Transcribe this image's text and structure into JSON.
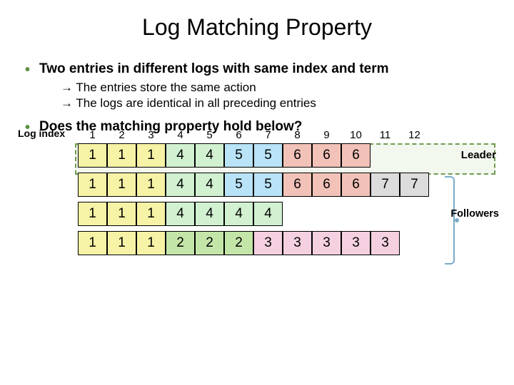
{
  "title": "Log Matching Property",
  "bullet1": "Two entries in different logs with same index and term",
  "sub1": "→ The entries store the same action",
  "sub2": "→ The logs are identical in all preceding entries",
  "bullet2": "Does the matching property hold below?",
  "logIndexLabel": "Log index",
  "indices": [
    "1",
    "2",
    "3",
    "4",
    "5",
    "6",
    "7",
    "8",
    "9",
    "10",
    "11",
    "12"
  ],
  "leaderLabel": "Leader",
  "followersLabel": "Followers",
  "rows": [
    {
      "role": "leader",
      "cells": [
        {
          "v": "1",
          "c": "c1"
        },
        {
          "v": "1",
          "c": "c1"
        },
        {
          "v": "1",
          "c": "c1"
        },
        {
          "v": "4",
          "c": "c3"
        },
        {
          "v": "4",
          "c": "c3"
        },
        {
          "v": "5",
          "c": "c4"
        },
        {
          "v": "5",
          "c": "c4"
        },
        {
          "v": "6",
          "c": "c5"
        },
        {
          "v": "6",
          "c": "c5"
        },
        {
          "v": "6",
          "c": "c5"
        }
      ]
    },
    {
      "role": "follower",
      "cells": [
        {
          "v": "1",
          "c": "c1"
        },
        {
          "v": "1",
          "c": "c1"
        },
        {
          "v": "1",
          "c": "c1"
        },
        {
          "v": "4",
          "c": "c3"
        },
        {
          "v": "4",
          "c": "c3"
        },
        {
          "v": "5",
          "c": "c4"
        },
        {
          "v": "5",
          "c": "c4"
        },
        {
          "v": "6",
          "c": "c5"
        },
        {
          "v": "6",
          "c": "c5"
        },
        {
          "v": "6",
          "c": "c5"
        },
        {
          "v": "7",
          "c": "c6"
        },
        {
          "v": "7",
          "c": "c6"
        }
      ]
    },
    {
      "role": "follower",
      "cells": [
        {
          "v": "1",
          "c": "c1"
        },
        {
          "v": "1",
          "c": "c1"
        },
        {
          "v": "1",
          "c": "c1"
        },
        {
          "v": "4",
          "c": "c3"
        },
        {
          "v": "4",
          "c": "c3"
        },
        {
          "v": "4",
          "c": "c3"
        },
        {
          "v": "4",
          "c": "c3"
        }
      ]
    },
    {
      "role": "follower",
      "cells": [
        {
          "v": "1",
          "c": "c1"
        },
        {
          "v": "1",
          "c": "c1"
        },
        {
          "v": "1",
          "c": "c1"
        },
        {
          "v": "2",
          "c": "c2"
        },
        {
          "v": "2",
          "c": "c2"
        },
        {
          "v": "2",
          "c": "c2"
        },
        {
          "v": "3",
          "c": "c7"
        },
        {
          "v": "3",
          "c": "c7"
        },
        {
          "v": "3",
          "c": "c7"
        },
        {
          "v": "3",
          "c": "c7"
        },
        {
          "v": "3",
          "c": "c7"
        }
      ]
    }
  ]
}
